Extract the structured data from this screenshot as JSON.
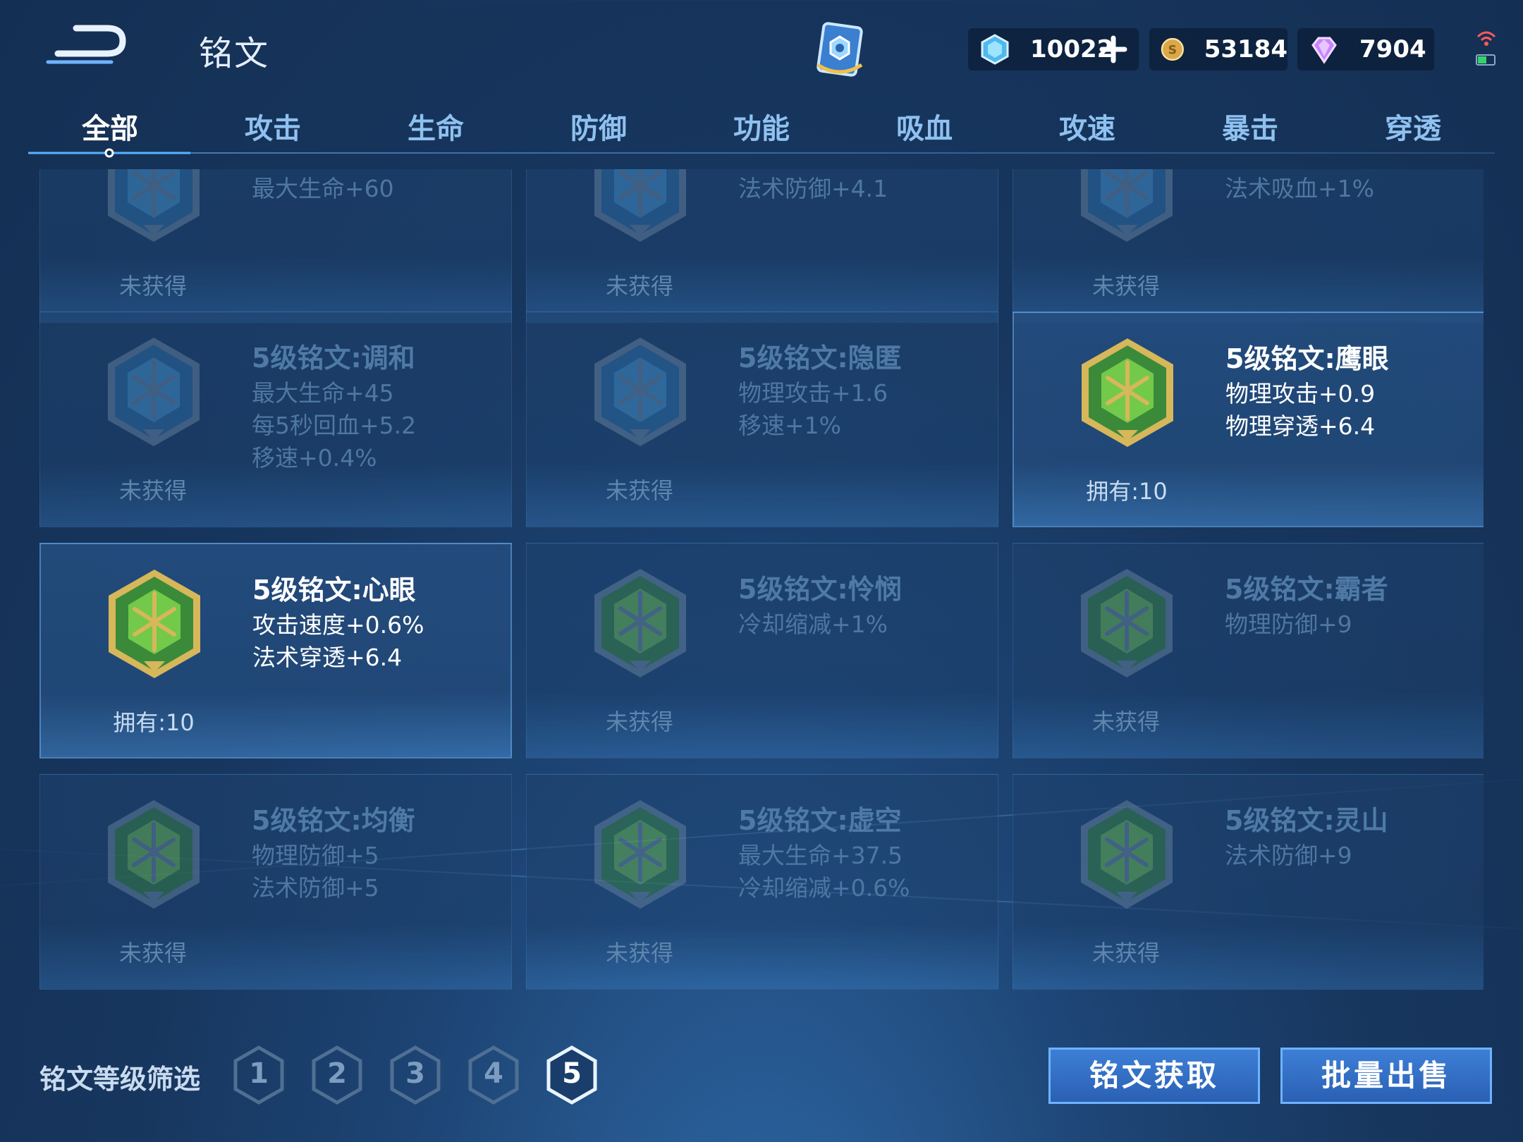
{
  "header": {
    "title": "铭文",
    "currencies": [
      {
        "name": "coupon",
        "value": "10022",
        "color": "#6fd3ff"
      },
      {
        "name": "gold",
        "value": "53184",
        "color": "#d9a84a"
      },
      {
        "name": "gem",
        "value": "7904",
        "color": "#c784ff"
      }
    ]
  },
  "tabs": [
    "全部",
    "攻击",
    "生命",
    "防御",
    "功能",
    "吸血",
    "攻速",
    "暴击",
    "穿透"
  ],
  "active_tab": 0,
  "cards": [
    {
      "name": "",
      "stats": [
        "最大生命+60"
      ],
      "status": "未获得",
      "owned": false,
      "gem": "blue"
    },
    {
      "name": "",
      "stats": [
        "法术防御+4.1"
      ],
      "status": "未获得",
      "owned": false,
      "gem": "blue"
    },
    {
      "name": "",
      "stats": [
        "法术吸血+1%"
      ],
      "status": "未获得",
      "owned": false,
      "gem": "blue"
    },
    {
      "name": "5级铭文:调和",
      "stats": [
        "最大生命+45",
        "每5秒回血+5.2",
        "移速+0.4%"
      ],
      "status": "未获得",
      "owned": false,
      "gem": "blue"
    },
    {
      "name": "5级铭文:隐匿",
      "stats": [
        "物理攻击+1.6",
        "移速+1%"
      ],
      "status": "未获得",
      "owned": false,
      "gem": "blue"
    },
    {
      "name": "5级铭文:鹰眼",
      "stats": [
        "物理攻击+0.9",
        "物理穿透+6.4"
      ],
      "status": "拥有:10",
      "owned": true,
      "gem": "green"
    },
    {
      "name": "5级铭文:心眼",
      "stats": [
        "攻击速度+0.6%",
        "法术穿透+6.4"
      ],
      "status": "拥有:10",
      "owned": true,
      "gem": "green"
    },
    {
      "name": "5级铭文:怜悯",
      "stats": [
        "冷却缩减+1%"
      ],
      "status": "未获得",
      "owned": false,
      "gem": "green"
    },
    {
      "name": "5级铭文:霸者",
      "stats": [
        "物理防御+9"
      ],
      "status": "未获得",
      "owned": false,
      "gem": "green"
    },
    {
      "name": "5级铭文:均衡",
      "stats": [
        "物理防御+5",
        "法术防御+5"
      ],
      "status": "未获得",
      "owned": false,
      "gem": "green"
    },
    {
      "name": "5级铭文:虚空",
      "stats": [
        "最大生命+37.5",
        "冷却缩减+0.6%"
      ],
      "status": "未获得",
      "owned": false,
      "gem": "green"
    },
    {
      "name": "5级铭文:灵山",
      "stats": [
        "法术防御+9"
      ],
      "status": "未获得",
      "owned": false,
      "gem": "green"
    }
  ],
  "bottom": {
    "filter_label": "铭文等级筛选",
    "levels": [
      "1",
      "2",
      "3",
      "4",
      "5"
    ],
    "active_level": "5",
    "get_button": "铭文获取",
    "sell_button": "批量出售"
  }
}
